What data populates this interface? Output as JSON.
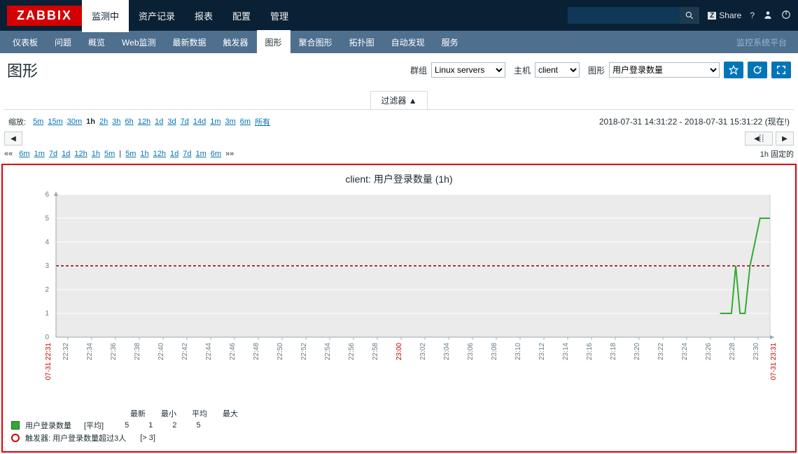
{
  "logo": "ZABBIX",
  "top_nav": [
    "监测中",
    "资产记录",
    "报表",
    "配置",
    "管理"
  ],
  "top_nav_active": 0,
  "share_label": "Share",
  "sub_nav": [
    "仪表板",
    "问题",
    "概览",
    "Web监测",
    "最新数据",
    "触发器",
    "图形",
    "聚合图形",
    "拓扑图",
    "自动发现",
    "服务"
  ],
  "sub_nav_active": 6,
  "sub_right": "监控系统平台",
  "page_title": "图形",
  "controls": {
    "group_label": "群组",
    "group_value": "Linux servers",
    "host_label": "主机",
    "host_value": "client",
    "graph_label": "图形",
    "graph_value": "用户登录数量"
  },
  "filter_tab": "过滤器  ▲",
  "zoom": {
    "label": "缩放:",
    "items": [
      "5m",
      "15m",
      "30m",
      "1h",
      "2h",
      "3h",
      "6h",
      "12h",
      "1d",
      "3d",
      "7d",
      "14d",
      "1m",
      "3m",
      "6m",
      "所有"
    ],
    "active": "1h"
  },
  "time_range": "2018-07-31 14:31:22 - 2018-07-31 15:31:22 (现在!)",
  "period_left": [
    "6m",
    "1m",
    "7d",
    "1d",
    "12h",
    "1h",
    "5m"
  ],
  "period_right": [
    "5m",
    "1h",
    "12h",
    "1d",
    "7d",
    "1m",
    "6m"
  ],
  "fixed": "1h  固定的",
  "chart_data": {
    "type": "line",
    "title": "client: 用户登录数量 (1h)",
    "ylabel": "",
    "ylim": [
      0,
      6
    ],
    "y_ticks": [
      0,
      1,
      2,
      3,
      4,
      5,
      6
    ],
    "threshold": 3,
    "x_start_label": "07-31 22:31",
    "x_end_label": "07-31 23:31",
    "x_ticks": [
      "22:32",
      "22:34",
      "22:36",
      "22:38",
      "22:40",
      "22:42",
      "22:44",
      "22:46",
      "22:48",
      "22:50",
      "22:52",
      "22:54",
      "22:56",
      "22:58",
      "23:00",
      "23:02",
      "23:04",
      "23:06",
      "23:08",
      "23:10",
      "23:12",
      "23:14",
      "23:16",
      "23:18",
      "23:20",
      "23:22",
      "23:24",
      "23:26",
      "23:28",
      "23:30"
    ],
    "x_red_tick": "23:00",
    "series": [
      {
        "name": "用户登录数量",
        "color": "#33aa33",
        "points": [
          {
            "t": 0.93,
            "v": 1
          },
          {
            "t": 0.946,
            "v": 1
          },
          {
            "t": 0.952,
            "v": 3
          },
          {
            "t": 0.958,
            "v": 1
          },
          {
            "t": 0.965,
            "v": 1
          },
          {
            "t": 0.972,
            "v": 3
          },
          {
            "t": 0.986,
            "v": 5
          },
          {
            "t": 1.0,
            "v": 5
          }
        ]
      }
    ]
  },
  "legend": {
    "series_label": "用户登录数量",
    "avg_word": "[平均]",
    "headers": [
      "最新",
      "最小",
      "平均",
      "最大"
    ],
    "values": [
      "5",
      "1",
      "2",
      "5"
    ],
    "trigger_label": "触发器: 用户登录数量超过3人",
    "trigger_expr": "[> 3]"
  }
}
